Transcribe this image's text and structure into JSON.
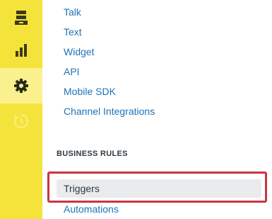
{
  "rail": {
    "background": "#f4e33a",
    "active_background": "#faf18e",
    "icons": [
      {
        "name": "archive-icon"
      },
      {
        "name": "bar-chart-icon"
      },
      {
        "name": "gear-icon",
        "active": true
      },
      {
        "name": "refresh-clock-icon"
      }
    ]
  },
  "nav": {
    "links": [
      "Talk",
      "Text",
      "Widget",
      "API",
      "Mobile SDK",
      "Channel Integrations"
    ],
    "section_title": "BUSINESS RULES",
    "rules": {
      "selected": "Triggers",
      "next": "Automations"
    }
  },
  "colors": {
    "link": "#1f73b7",
    "highlight_border": "#cc3340",
    "selected_bg": "#e9ebed"
  }
}
